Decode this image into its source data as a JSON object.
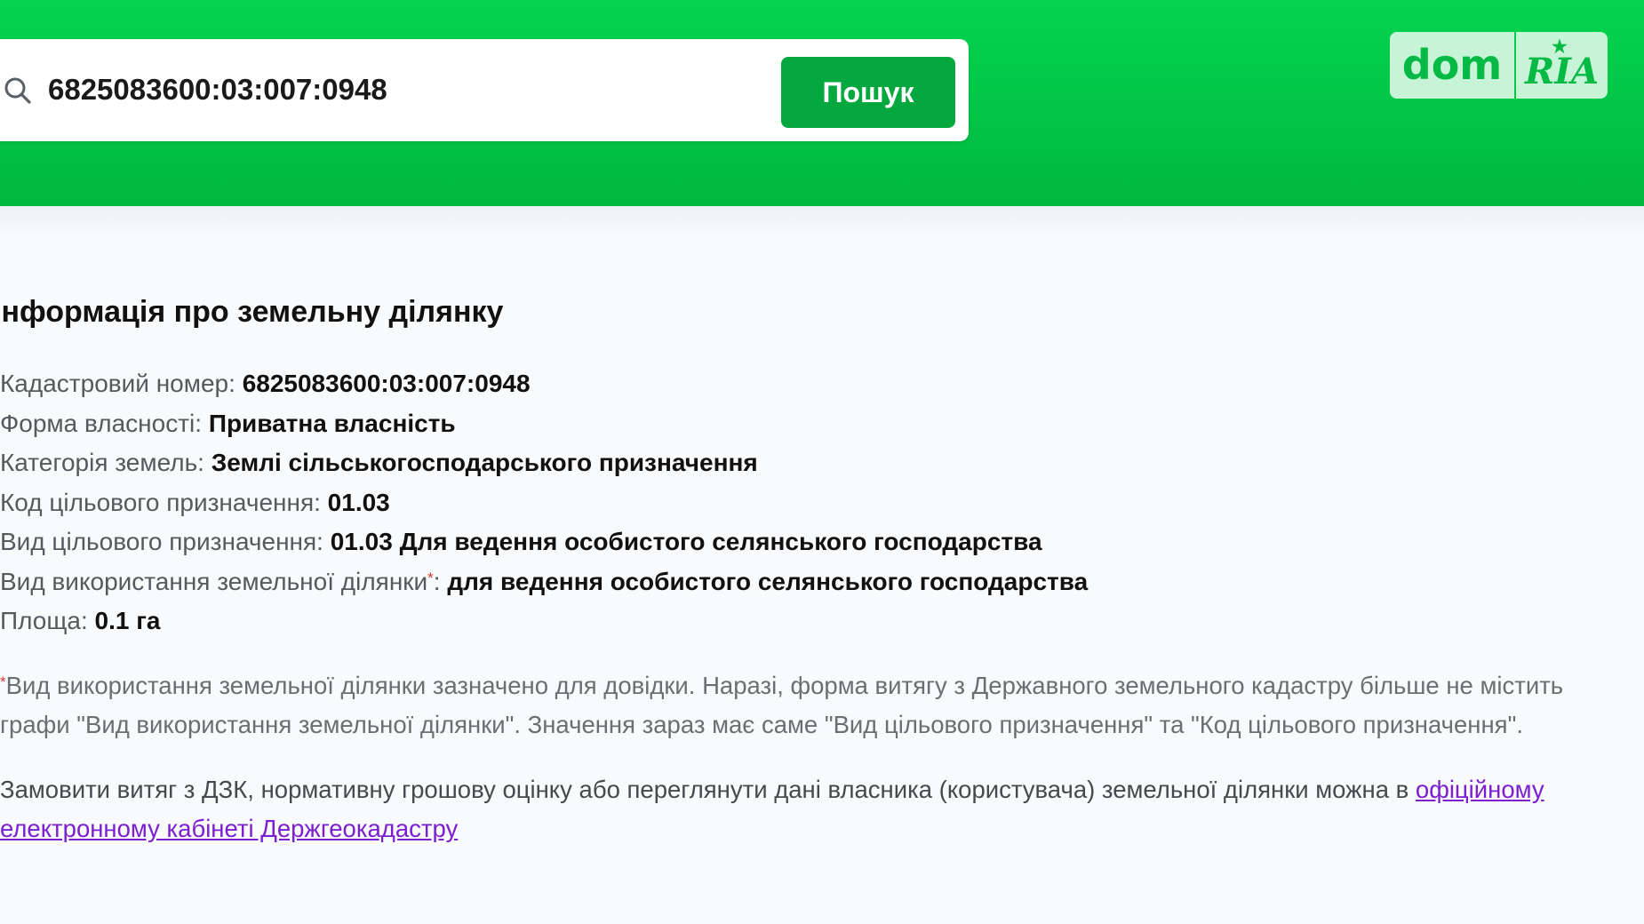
{
  "search": {
    "value": "6825083600:03:007:0948",
    "button_label": "Пошук"
  },
  "logo": {
    "part1": "dom",
    "part2": "RIA"
  },
  "info": {
    "title": "Інформація про земельну ділянку",
    "fields": [
      {
        "label": "Кадастровий номер: ",
        "value": "6825083600:03:007:0948"
      },
      {
        "label": "Форма власності: ",
        "value": "Приватна власність"
      },
      {
        "label": "Категорія земель: ",
        "value": "Землі сільськогосподарського призначення"
      },
      {
        "label": "Код цільового призначення: ",
        "value": "01.03"
      },
      {
        "label": "Вид цільового призначення: ",
        "value": "01.03 Для ведення особистого селянського господарства"
      },
      {
        "label": "Вид використання земельної ділянки",
        "asterisk": "*",
        "label_suffix": ": ",
        "value": "для ведення особистого селянського господарства"
      },
      {
        "label": "Площа: ",
        "value": "0.1 га"
      }
    ],
    "note_asterisk": "*",
    "note": "Вид використання земельної ділянки зазначено для довідки. Наразі, форма витягу з Державного земельного кадастру більше не містить графи \"Вид використання земельної ділянки\". Значення зараз має саме \"Вид цільового призначення\" та \"Код цільового призначення\".",
    "order_text": "Замовити витяг з ДЗК, нормативну грошову оцінку або переглянути дані власника (користувача) земельної ділянки можна в ",
    "order_link": "офіційному електронному кабінеті Держгеокадастру"
  },
  "colors": {
    "header": "#04d44f",
    "button": "#05a83e",
    "link": "#7b1fd1",
    "asterisk": "#e03535"
  }
}
